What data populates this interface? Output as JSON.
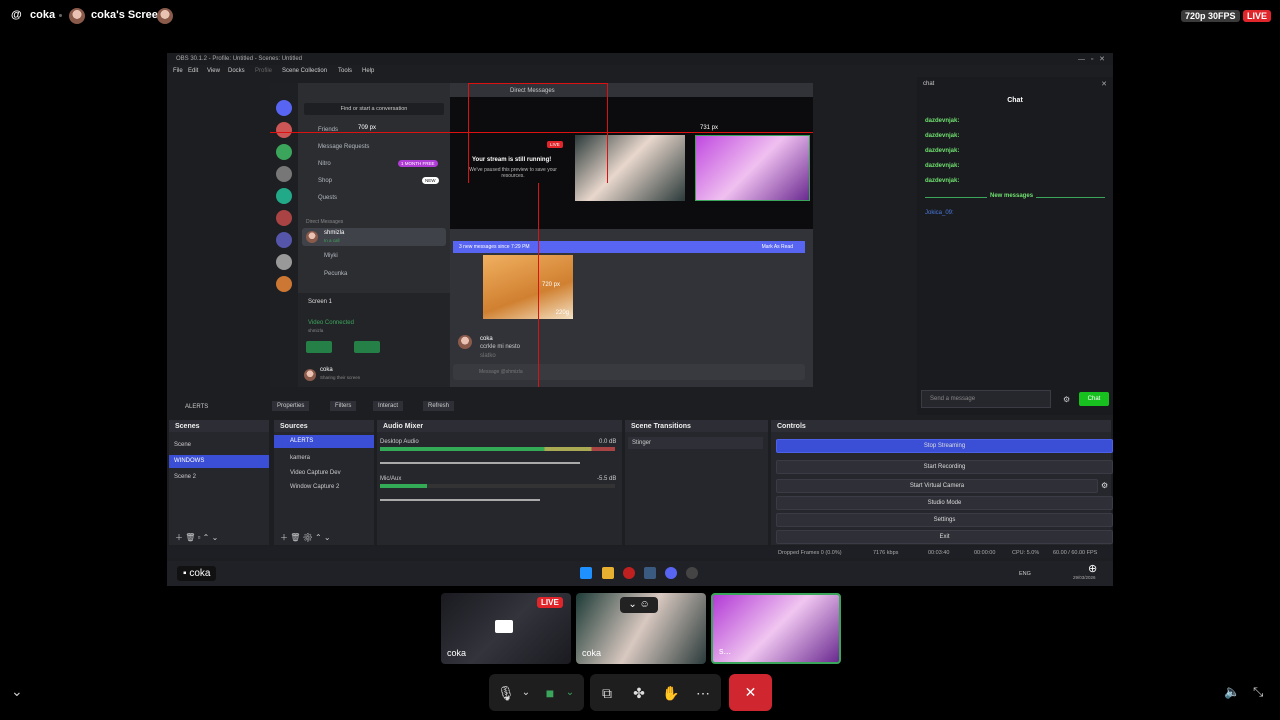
{
  "topbar": {
    "at": "@",
    "user": "coka",
    "screen": "coka's Screen",
    "quality": "720p 30FPS",
    "live": "LIVE"
  },
  "obs": {
    "title": "OBS 30.1.2 - Profile: Untitled - Scenes: Untitled",
    "menu": [
      "File",
      "Edit",
      "View",
      "Docks",
      "Profile",
      "Scene Collection",
      "Tools",
      "Help"
    ],
    "source_label": "ALERTS",
    "toolbar": [
      "Properties",
      "Filters",
      "Interact",
      "Refresh"
    ],
    "scenes_title": "Scenes",
    "scenes": [
      "Scene",
      "WINDOWS",
      "Scene 2"
    ],
    "sources_title": "Sources",
    "sources": [
      "ALERTS",
      "kamera",
      "Video Capture Dev",
      "Window Capture 2"
    ],
    "mixer_title": "Audio Mixer",
    "mixer": [
      {
        "name": "Desktop Audio",
        "db": "0.0 dB"
      },
      {
        "name": "Mic/Aux",
        "db": "-5.5 dB"
      }
    ],
    "transitions_title": "Scene Transitions",
    "transition": "Stinger",
    "controls_title": "Controls",
    "controls": [
      "Stop Streaming",
      "Start Recording",
      "Start Virtual Camera",
      "Studio Mode",
      "Settings",
      "Exit"
    ],
    "status": {
      "dropped": "Dropped Frames 0 (0.0%)",
      "kbps": "7176 kbps",
      "live_time": "00:03:40",
      "rec_time": "00:00:00",
      "cpu": "CPU: 5.0%",
      "fps": "60.00 / 60.00 FPS"
    },
    "taskbar": {
      "lang": "ENG",
      "date": "29/03/2026"
    }
  },
  "discord": {
    "search": "Find or start a conversation",
    "window_title": "Direct Messages",
    "items": [
      "Friends",
      "Message Requests",
      "Nitro",
      "Shop",
      "Quests"
    ],
    "nitro_badge": "1 MONTH FREE",
    "shop_badge": "NEW",
    "dm_header": "Direct Messages",
    "dms": [
      "shmizla",
      "Miyki",
      "Pecunka"
    ],
    "dm_status": "In a call",
    "screen_label": "Screen 1",
    "video_connected": "Video Connected",
    "video_user": "shmizla",
    "user": "coka",
    "user_status": "Sharing their screen",
    "stream_title": "Your stream is still running!",
    "stream_sub": "We've paused this preview to save your resources.",
    "live": "LIVE",
    "new_messages_bar": "3 new messages since 7:29 PM",
    "mark_read": "Mark As Read",
    "msg_user": "coka",
    "msg_text": "ccrkle mi nesto",
    "msg_text2": "slatko",
    "msg_placeholder": "Message @shmizla",
    "dim_1": "709 px",
    "dim_2": "731 px",
    "dim_3": "720 px",
    "product_weight": "220g"
  },
  "chat": {
    "dock_title": "chat",
    "title": "Chat",
    "lines": [
      "dazdevnjak:",
      "dazdevnjak:",
      "dazdevnjak:",
      "dazdevnjak:",
      "dazdevnjak:"
    ],
    "new_messages": "New messages",
    "last_user": "Jokica_09:",
    "input_placeholder": "Send a message",
    "send": "Chat"
  },
  "overlay_label": "coka",
  "tiles": [
    {
      "label": "coka",
      "live": "LIVE"
    },
    {
      "label": "coka"
    },
    {
      "label": "s..."
    }
  ],
  "colors": {
    "live": "#e0262b",
    "accent": "#3b4fd6",
    "end_call": "#d0262f"
  }
}
